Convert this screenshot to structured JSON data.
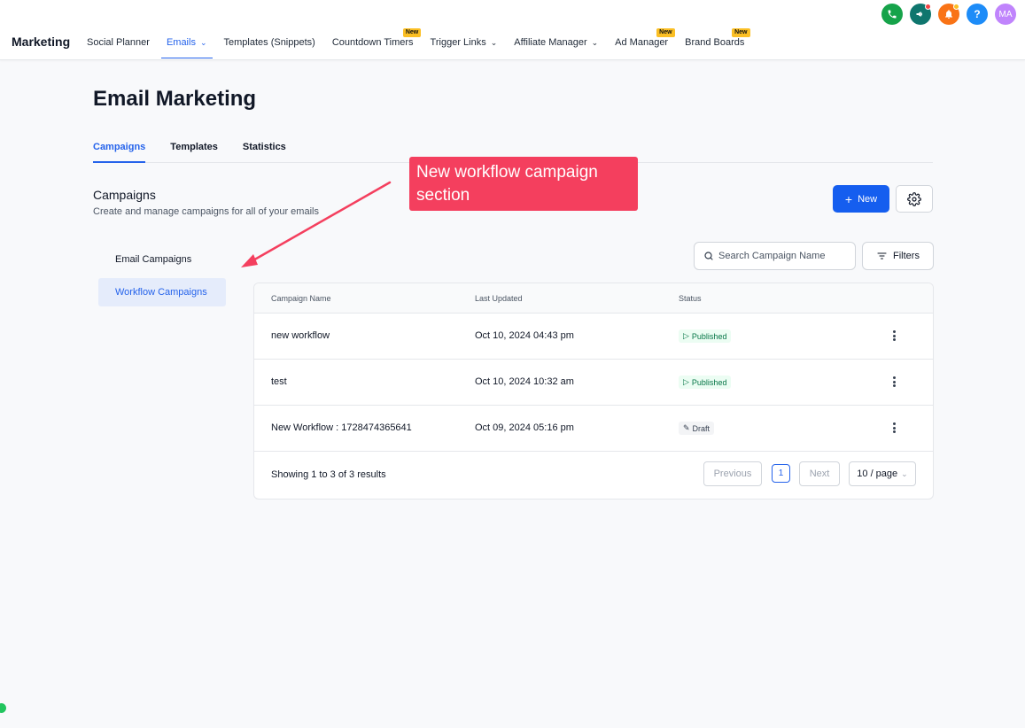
{
  "app": {
    "title": "Marketing"
  },
  "nav": [
    {
      "label": "Social Planner"
    },
    {
      "label": "Emails",
      "active": true,
      "dropdown": true
    },
    {
      "label": "Templates (Snippets)"
    },
    {
      "label": "Countdown Timers",
      "badge": "New"
    },
    {
      "label": "Trigger Links",
      "dropdown": true
    },
    {
      "label": "Affiliate Manager",
      "dropdown": true
    },
    {
      "label": "Ad Manager",
      "badge": "New"
    },
    {
      "label": "Brand Boards",
      "badge": "New"
    }
  ],
  "top_icons": [
    {
      "icon": "phone-icon",
      "color": "#16a34a"
    },
    {
      "icon": "megaphone-icon",
      "color": "#0f766e"
    },
    {
      "icon": "bell-icon",
      "color": "#f97316"
    },
    {
      "icon": "help-icon",
      "label": "?",
      "color": "#1d8cf8"
    },
    {
      "icon": "avatar",
      "label": "MA",
      "color": "#c084fc"
    }
  ],
  "page": {
    "title": "Email Marketing",
    "tabs": [
      {
        "label": "Campaigns",
        "active": true
      },
      {
        "label": "Templates"
      },
      {
        "label": "Statistics"
      }
    ],
    "section_title": "Campaigns",
    "section_subtitle": "Create and manage campaigns for all of your emails",
    "new_button": "New",
    "new_button_icon": "+"
  },
  "sidebar": [
    {
      "label": "Email Campaigns"
    },
    {
      "label": "Workflow Campaigns",
      "active": true
    }
  ],
  "search": {
    "placeholder": "Search Campaign Name"
  },
  "filters_label": "Filters",
  "table": {
    "columns": [
      "Campaign Name",
      "Last Updated",
      "Status"
    ],
    "rows": [
      {
        "name": "new workflow",
        "updated": "Oct 10, 2024 04:43 pm",
        "status": "Published"
      },
      {
        "name": "test",
        "updated": "Oct 10, 2024 10:32 am",
        "status": "Published"
      },
      {
        "name": "New Workflow : 1728474365641",
        "updated": "Oct 09, 2024 05:16 pm",
        "status": "Draft"
      }
    ],
    "showing": "Showing 1 to 3 of 3 results",
    "pagination": {
      "previous": "Previous",
      "current": "1",
      "next": "Next",
      "page_size": "10 / page"
    }
  },
  "annotation": {
    "text": "New workflow campaign section",
    "color": "#f43f5e"
  }
}
